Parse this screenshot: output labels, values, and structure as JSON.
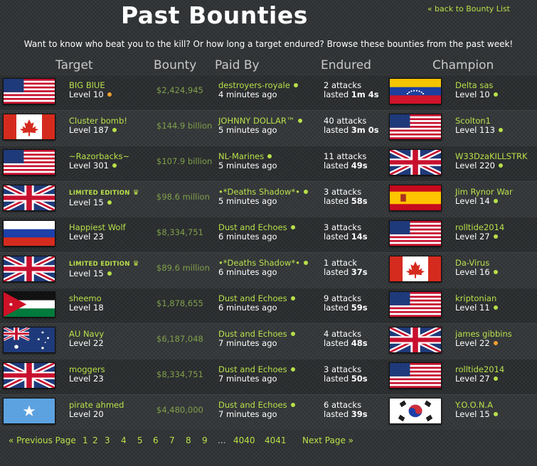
{
  "header": {
    "title": "Past Bounties",
    "back_link": "« back to Bounty List",
    "intro": "Want to know who beat you to the kill? Or how long a target endured? Browse these bounties from the past week!"
  },
  "columns": {
    "target": "Target",
    "bounty": "Bounty",
    "paid_by": "Paid By",
    "endured": "Endured",
    "champion": "Champion"
  },
  "rows": [
    {
      "target_flag": "us",
      "target_name": "BIG BlUE",
      "target_level": "Level 10",
      "target_status": "orange",
      "target_limited": false,
      "bounty": "$2,424,945",
      "paid_by": "destroyers-royale",
      "paid_time": "4 minutes ago",
      "attacks": "2 attacks",
      "lasted_prefix": "lasted ",
      "lasted": "1m 4s",
      "champ_flag": "ve",
      "champ_name": "Delta sas",
      "champ_level": "Level 10",
      "champ_status": "green"
    },
    {
      "target_flag": "ca",
      "target_name": "Cluster bomb!",
      "target_level": "Level 187",
      "target_status": "green",
      "target_limited": false,
      "bounty": "$144.9 billion",
      "paid_by": "JOHNNY DOLLAR™",
      "paid_time": "5 minutes ago",
      "attacks": "40 attacks",
      "lasted_prefix": "lasted ",
      "lasted": "3m 0s",
      "champ_flag": "us",
      "champ_name": "Scolton1",
      "champ_level": "Level 113",
      "champ_status": "green"
    },
    {
      "target_flag": "us",
      "target_name": "~Razorbacks~",
      "target_level": "Level 301",
      "target_status": "green",
      "target_limited": false,
      "bounty": "$107.9 billion",
      "paid_by": "NL-Marines",
      "paid_time": "5 minutes ago",
      "attacks": "11 attacks",
      "lasted_prefix": "lasted ",
      "lasted": "49s",
      "champ_flag": "uk",
      "champ_name": "W33DzaKILLSTRK",
      "champ_level": "Level 220",
      "champ_status": "green"
    },
    {
      "target_flag": "uk",
      "target_name": "LIMITED EDITION",
      "target_level": "Level 15",
      "target_status": "green",
      "target_limited": true,
      "bounty": "$98.6 million",
      "paid_by": "•*Deaths Shadow*•",
      "paid_time": "5 minutes ago",
      "attacks": "3 attacks",
      "lasted_prefix": "lasted ",
      "lasted": "58s",
      "champ_flag": "es",
      "champ_name": "Jim Rynor War",
      "champ_level": "Level 14",
      "champ_status": "green"
    },
    {
      "target_flag": "ru",
      "target_name": "Happiest Wolf",
      "target_level": "Level 23",
      "target_status": "",
      "target_limited": false,
      "bounty": "$8,334,751",
      "paid_by": "Dust and Echoes",
      "paid_time": "6 minutes ago",
      "attacks": "3 attacks",
      "lasted_prefix": "lasted ",
      "lasted": "14s",
      "champ_flag": "us",
      "champ_name": "rolltide2014",
      "champ_level": "Level 27",
      "champ_status": "green"
    },
    {
      "target_flag": "uk",
      "target_name": "LIMITED EDITION",
      "target_level": "Level 15",
      "target_status": "green",
      "target_limited": true,
      "bounty": "$89.6 million",
      "paid_by": "•*Deaths Shadow*•",
      "paid_time": "6 minutes ago",
      "attacks": "1 attack",
      "lasted_prefix": "lasted ",
      "lasted": "37s",
      "champ_flag": "ca",
      "champ_name": "Da-Virus",
      "champ_level": "Level 16",
      "champ_status": "green"
    },
    {
      "target_flag": "jo",
      "target_name": "sheemo",
      "target_level": "Level 18",
      "target_status": "",
      "target_limited": false,
      "bounty": "$1,878,655",
      "paid_by": "Dust and Echoes",
      "paid_time": "6 minutes ago",
      "attacks": "9 attacks",
      "lasted_prefix": "lasted ",
      "lasted": "59s",
      "champ_flag": "us",
      "champ_name": "kriptonian",
      "champ_level": "Level 11",
      "champ_status": "green"
    },
    {
      "target_flag": "au",
      "target_name": "AU Navy",
      "target_level": "Level 22",
      "target_status": "",
      "target_limited": false,
      "bounty": "$6,187,048",
      "paid_by": "Dust and Echoes",
      "paid_time": "7 minutes ago",
      "attacks": "4 attacks",
      "lasted_prefix": "lasted ",
      "lasted": "48s",
      "champ_flag": "uk",
      "champ_name": "james gibbins",
      "champ_level": "Level 22",
      "champ_status": "orange"
    },
    {
      "target_flag": "uk",
      "target_name": "moggers",
      "target_level": "Level 23",
      "target_status": "",
      "target_limited": false,
      "bounty": "$8,334,751",
      "paid_by": "Dust and Echoes",
      "paid_time": "7 minutes ago",
      "attacks": "3 attacks",
      "lasted_prefix": "lasted ",
      "lasted": "50s",
      "champ_flag": "us",
      "champ_name": "rolltide2014",
      "champ_level": "Level 27",
      "champ_status": "green"
    },
    {
      "target_flag": "so",
      "target_name": "pirate ahmed",
      "target_level": "Level 20",
      "target_status": "",
      "target_limited": false,
      "bounty": "$4,480,000",
      "paid_by": "Dust and Echoes",
      "paid_time": "7 minutes ago",
      "attacks": "6 attacks",
      "lasted_prefix": "lasted ",
      "lasted": "39s",
      "champ_flag": "kr",
      "champ_name": "Y.O.O.N.A",
      "champ_level": "Level 15",
      "champ_status": "green"
    }
  ],
  "pagination": {
    "prev": "« Previous Page",
    "pages": [
      "1",
      "2",
      "3",
      "4",
      "5",
      "6",
      "7",
      "8",
      "9",
      "...",
      "4040",
      "4041"
    ],
    "next": "Next Page »"
  },
  "colors": {
    "accent": "#b8e04a",
    "background": "#2e3133",
    "bounty_text": "#7fa04a"
  }
}
